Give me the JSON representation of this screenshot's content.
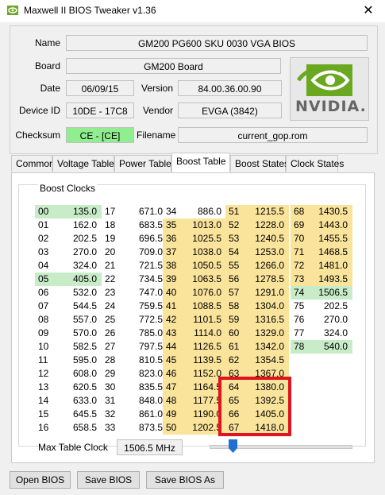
{
  "window": {
    "title": "Maxwell II BIOS Tweaker v1.36",
    "close_glyph": "✕"
  },
  "info": {
    "name_label": "Name",
    "name_value": "GM200 PG600 SKU 0030 VGA BIOS",
    "board_label": "Board",
    "board_value": "GM200 Board",
    "date_label": "Date",
    "date_value": "06/09/15",
    "version_label": "Version",
    "version_value": "84.00.36.00.90",
    "device_label": "Device ID",
    "device_value": "10DE - 17C8",
    "vendor_label": "Vendor",
    "vendor_value": "EVGA (3842)",
    "checksum_label": "Checksum",
    "checksum_value": "CE - [CE]",
    "filename_label": "Filename",
    "filename_value": "current_gop.rom",
    "logo_text": "NVIDIA."
  },
  "tabs": [
    "Common",
    "Voltage Table",
    "Power Table",
    "Boost Table",
    "Boost States",
    "Clock States"
  ],
  "active_tab": "Boost Table",
  "boost": {
    "group_title": "Boost Clocks",
    "max_label": "Max Table Clock",
    "max_value": "1506.5 MHz",
    "columns": [
      {
        "start": 0,
        "rows": [
          {
            "i": "00",
            "v": "135.0",
            "bg": "green"
          },
          {
            "i": "01",
            "v": "162.0"
          },
          {
            "i": "02",
            "v": "202.5"
          },
          {
            "i": "03",
            "v": "270.0"
          },
          {
            "i": "04",
            "v": "324.0"
          },
          {
            "i": "05",
            "v": "405.0",
            "bg": "green"
          },
          {
            "i": "06",
            "v": "532.0"
          },
          {
            "i": "07",
            "v": "544.5"
          },
          {
            "i": "08",
            "v": "557.0"
          },
          {
            "i": "09",
            "v": "570.0"
          },
          {
            "i": "10",
            "v": "582.5"
          },
          {
            "i": "11",
            "v": "595.0"
          },
          {
            "i": "12",
            "v": "608.0"
          },
          {
            "i": "13",
            "v": "620.5"
          },
          {
            "i": "14",
            "v": "633.0"
          },
          {
            "i": "15",
            "v": "645.5"
          },
          {
            "i": "16",
            "v": "658.5"
          }
        ]
      },
      {
        "start": 17,
        "rows": [
          {
            "i": "17",
            "v": "671.0"
          },
          {
            "i": "18",
            "v": "683.5"
          },
          {
            "i": "19",
            "v": "696.5"
          },
          {
            "i": "20",
            "v": "709.0"
          },
          {
            "i": "21",
            "v": "721.5"
          },
          {
            "i": "22",
            "v": "734.5"
          },
          {
            "i": "23",
            "v": "747.0"
          },
          {
            "i": "24",
            "v": "759.5"
          },
          {
            "i": "25",
            "v": "772.5"
          },
          {
            "i": "26",
            "v": "785.0"
          },
          {
            "i": "27",
            "v": "797.5"
          },
          {
            "i": "28",
            "v": "810.5"
          },
          {
            "i": "29",
            "v": "823.0"
          },
          {
            "i": "30",
            "v": "835.5"
          },
          {
            "i": "31",
            "v": "848.0"
          },
          {
            "i": "32",
            "v": "861.0"
          },
          {
            "i": "33",
            "v": "873.5"
          }
        ]
      },
      {
        "start": 34,
        "rows": [
          {
            "i": "34",
            "v": "886.0"
          },
          {
            "i": "35",
            "v": "1013.0",
            "bg": "yellow"
          },
          {
            "i": "36",
            "v": "1025.5",
            "bg": "yellow"
          },
          {
            "i": "37",
            "v": "1038.0",
            "bg": "yellow"
          },
          {
            "i": "38",
            "v": "1050.5",
            "bg": "yellow"
          },
          {
            "i": "39",
            "v": "1063.5",
            "bg": "yellow"
          },
          {
            "i": "40",
            "v": "1076.0",
            "bg": "yellow"
          },
          {
            "i": "41",
            "v": "1088.5",
            "bg": "yellow"
          },
          {
            "i": "42",
            "v": "1101.5",
            "bg": "yellow"
          },
          {
            "i": "43",
            "v": "1114.0",
            "bg": "yellow"
          },
          {
            "i": "44",
            "v": "1126.5",
            "bg": "yellow"
          },
          {
            "i": "45",
            "v": "1139.5",
            "bg": "yellow"
          },
          {
            "i": "46",
            "v": "1152.0",
            "bg": "yellow"
          },
          {
            "i": "47",
            "v": "1164.5",
            "bg": "yellow"
          },
          {
            "i": "48",
            "v": "1177.5",
            "bg": "yellow"
          },
          {
            "i": "49",
            "v": "1190.0",
            "bg": "yellow"
          },
          {
            "i": "50",
            "v": "1202.5",
            "bg": "yellow"
          }
        ]
      },
      {
        "start": 51,
        "rows": [
          {
            "i": "51",
            "v": "1215.5",
            "bg": "yellow"
          },
          {
            "i": "52",
            "v": "1228.0",
            "bg": "yellow"
          },
          {
            "i": "53",
            "v": "1240.5",
            "bg": "yellow"
          },
          {
            "i": "54",
            "v": "1253.0",
            "bg": "yellow"
          },
          {
            "i": "55",
            "v": "1266.0",
            "bg": "yellow"
          },
          {
            "i": "56",
            "v": "1278.5",
            "bg": "yellow"
          },
          {
            "i": "57",
            "v": "1291.0",
            "bg": "yellow"
          },
          {
            "i": "58",
            "v": "1304.0",
            "bg": "yellow"
          },
          {
            "i": "59",
            "v": "1316.5",
            "bg": "yellow"
          },
          {
            "i": "60",
            "v": "1329.0",
            "bg": "yellow"
          },
          {
            "i": "61",
            "v": "1342.0",
            "bg": "yellow"
          },
          {
            "i": "62",
            "v": "1354.5",
            "bg": "yellow"
          },
          {
            "i": "63",
            "v": "1367.0",
            "bg": "yellow"
          },
          {
            "i": "64",
            "v": "1380.0",
            "bg": "yellow"
          },
          {
            "i": "65",
            "v": "1392.5",
            "bg": "yellow"
          },
          {
            "i": "66",
            "v": "1405.0",
            "bg": "yellow"
          },
          {
            "i": "67",
            "v": "1418.0",
            "bg": "yellow"
          }
        ]
      },
      {
        "start": 68,
        "rows": [
          {
            "i": "68",
            "v": "1430.5",
            "bg": "yellow"
          },
          {
            "i": "69",
            "v": "1443.0",
            "bg": "yellow"
          },
          {
            "i": "70",
            "v": "1455.5",
            "bg": "yellow"
          },
          {
            "i": "71",
            "v": "1468.5",
            "bg": "yellow"
          },
          {
            "i": "72",
            "v": "1481.0",
            "bg": "yellow"
          },
          {
            "i": "73",
            "v": "1493.5",
            "bg": "yellow"
          },
          {
            "i": "74",
            "v": "1506.5",
            "bg": "green"
          },
          {
            "i": "75",
            "v": "202.5"
          },
          {
            "i": "76",
            "v": "270.0"
          },
          {
            "i": "77",
            "v": "324.0"
          },
          {
            "i": "78",
            "v": "540.0",
            "bg": "green"
          }
        ]
      }
    ]
  },
  "buttons": {
    "open": "Open BIOS",
    "save": "Save BIOS",
    "save_as": "Save BIOS As"
  },
  "colors": {
    "yellow": "#fae49c",
    "green_cell": "#c8ecc8",
    "checksum_green": "#90ee90",
    "highlight": "#e0141e",
    "slider": "#1e6fd0"
  }
}
